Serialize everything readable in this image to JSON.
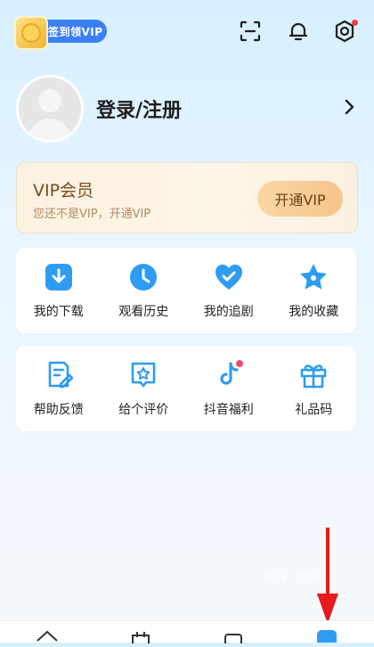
{
  "header": {
    "checkin_label": "签到领VIP",
    "icons": [
      "scan-icon",
      "bell-icon",
      "settings-icon"
    ]
  },
  "profile": {
    "login_label": "登录/注册"
  },
  "vip_card": {
    "title": "VIP会员",
    "subtitle": "您还不是VIP，开通VIP",
    "button_label": "开通VIP",
    "accent": "#f5c58b"
  },
  "features_primary": [
    {
      "label": "我的下载",
      "icon": "download-icon"
    },
    {
      "label": "观看历史",
      "icon": "clock-icon"
    },
    {
      "label": "我的追剧",
      "icon": "heart-check-icon"
    },
    {
      "label": "我的收藏",
      "icon": "star-icon"
    }
  ],
  "features_secondary": [
    {
      "label": "帮助反馈",
      "icon": "feedback-icon"
    },
    {
      "label": "给个评价",
      "icon": "rating-star-icon"
    },
    {
      "label": "抖音福利",
      "icon": "tiktok-icon"
    },
    {
      "label": "礼品码",
      "icon": "gift-icon"
    }
  ],
  "watermark": "知乎 @站",
  "colors": {
    "brand_blue": "#3b7ff5",
    "icon_blue": "#2e9cf2",
    "arrow_red": "#e51b1b"
  }
}
